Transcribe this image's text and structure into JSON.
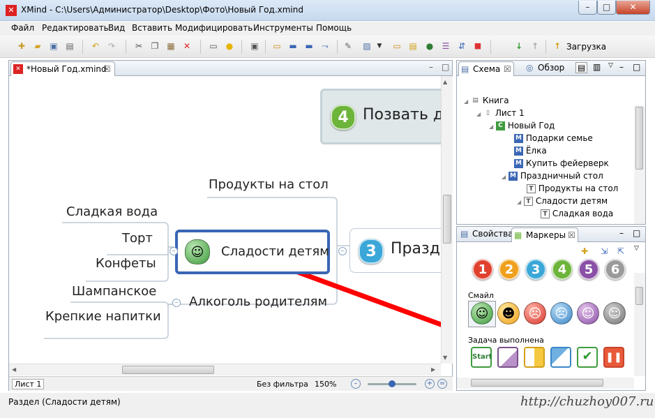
{
  "window": {
    "title": "XMind - C:\\Users\\Администратор\\Desktop\\Фото\\Новый Год.xmind",
    "minimize": "–",
    "maximize": "□",
    "close": "✕"
  },
  "menu": [
    "Файл",
    "Редактировать",
    "Вид",
    "Вставить",
    "Модифицировать",
    "Инструменты",
    "Помощь"
  ],
  "toolbar": {
    "upload_label": "Загрузка",
    "icons": [
      "new-file-icon",
      "open-folder-icon",
      "save-icon",
      "print-icon",
      "undo-icon",
      "redo-icon",
      "cut-icon",
      "copy-icon",
      "paste-icon",
      "delete-icon",
      "presentation-icon",
      "idea-icon",
      "export-icon",
      "topic-icon",
      "subtopic-icon",
      "floating-topic-icon",
      "relationship-icon",
      "attachment-icon",
      "image-icon",
      "dropdown-icon",
      "boundary-icon",
      "note-icon",
      "hyperlink-icon",
      "summary-icon",
      "marker-icon",
      "stop-icon",
      "drill-down-icon",
      "drill-up-icon",
      "upload-icon"
    ]
  },
  "editor": {
    "tab_label": "*Новый Год.xmind",
    "sheet_tab": "Лист 1",
    "filter": "Без фильтра",
    "zoom": "150%",
    "zoom_level": 0.5
  },
  "mindmap": {
    "topic_right_top": "Позвать д",
    "topic_right_top_number": "4",
    "topic_right_mid": "Празд",
    "topic_right_mid_number": "3",
    "selected_topic": "Сладости детям",
    "branch_products": "Продукты на стол",
    "branch_alcohol": "Алкоголь родителям",
    "sub_sweets": [
      "Сладкая вода",
      "Торт",
      "Конфеты"
    ],
    "sub_alcohol": [
      "Шампанское",
      "Крепкие напитки"
    ]
  },
  "outline_panel": {
    "tab_scheme": "Схема",
    "tab_overview": "Обзор",
    "tree": [
      {
        "icon": "book",
        "label": "Книга"
      },
      {
        "icon": "sheet",
        "label": "Лист 1"
      },
      {
        "icon": "C",
        "label": "Новый Год"
      },
      {
        "icon": "M",
        "label": "Подарки семье"
      },
      {
        "icon": "M",
        "label": "Ёлка"
      },
      {
        "icon": "M",
        "label": "Купить фейерверк"
      },
      {
        "icon": "M",
        "label": "Праздничный стол"
      },
      {
        "icon": "T",
        "label": "Продукты на стол"
      },
      {
        "icon": "T",
        "label": "Сладости детям"
      },
      {
        "icon": "T",
        "label": "Сладкая вода"
      }
    ]
  },
  "markers_panel": {
    "tab_properties": "Свойства",
    "tab_markers": "Маркеры",
    "priority_numbers": [
      "1",
      "2",
      "3",
      "4",
      "5",
      "6"
    ],
    "priority_colors": [
      "#e0412e",
      "#f0a01c",
      "#3aa7d8",
      "#6cb43a",
      "#8a4fa6",
      "#9a9a9a"
    ],
    "smiley_label": "Смайл",
    "smileys": [
      "smile-icon",
      "laugh-icon",
      "angry-icon",
      "cry-icon",
      "surprise-icon",
      "sleep-icon"
    ],
    "task_label": "Задача выполнена",
    "task_start": "Start"
  },
  "status": {
    "text": "Раздел (Сладости детям)",
    "watermark": "http://chuzhoy007.ru"
  },
  "colors": {
    "accent_blue": "#3a66b4",
    "arrow_red": "#ff0000",
    "topic_green": "#7fc98a"
  }
}
